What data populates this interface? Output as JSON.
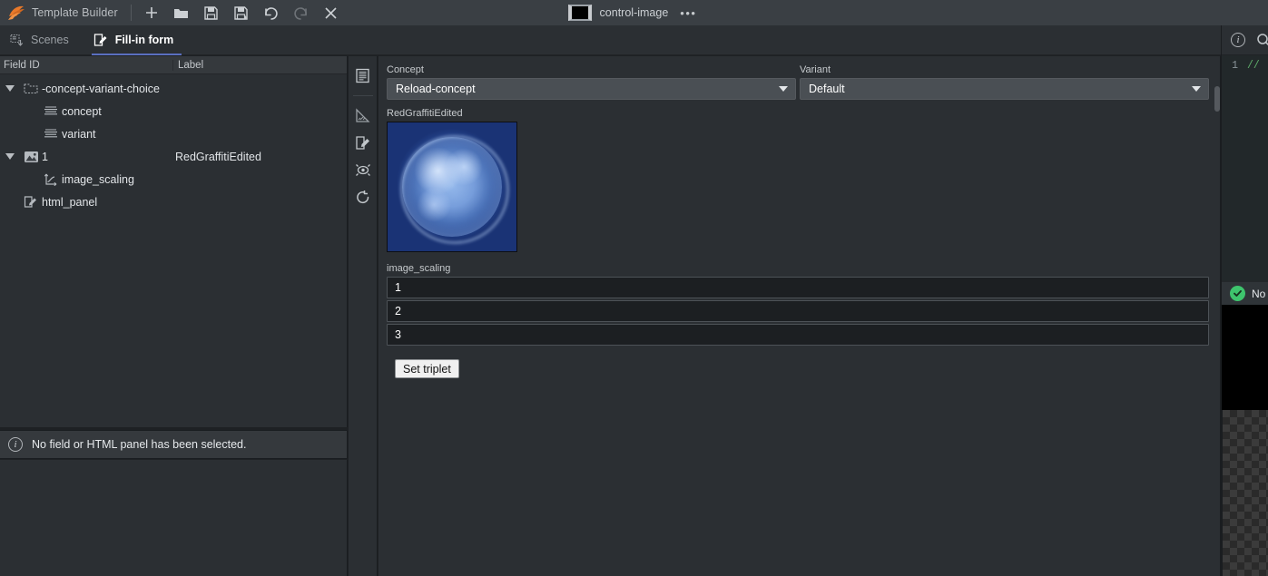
{
  "app": {
    "title": "Template Builder",
    "logo_icon": "orange-feather-logo",
    "toolbar": [
      {
        "name": "new",
        "icon": "plus-icon",
        "label": "New"
      },
      {
        "name": "open",
        "icon": "folder-open-icon",
        "label": "Open"
      },
      {
        "name": "save",
        "icon": "save-floppy-icon",
        "label": "Save"
      },
      {
        "name": "save-as",
        "icon": "save-as-floppy-icon",
        "label": "Save As"
      },
      {
        "name": "undo",
        "icon": "undo-arrow-icon",
        "label": "Undo"
      },
      {
        "name": "redo",
        "icon": "redo-arrow-icon",
        "label": "Redo"
      },
      {
        "name": "close",
        "icon": "close-x-icon",
        "label": "Close"
      }
    ],
    "document": {
      "icon": "image-strip-icon",
      "name": "control-image",
      "overflow": "•••"
    }
  },
  "tabs": [
    {
      "label": "Scenes",
      "icon": "scenes-icon",
      "active": false
    },
    {
      "label": "Fill-in form",
      "icon": "fill-in-form-icon",
      "active": true
    }
  ],
  "tree": {
    "columns": {
      "field_id": "Field ID",
      "label": "Label"
    },
    "rows": [
      {
        "id": "-concept-variant-choice",
        "label": "",
        "icon": "folder-icon",
        "indent": 0,
        "expandable": true,
        "expanded": true
      },
      {
        "id": "concept",
        "label": "",
        "icon": "list-lines-icon",
        "indent": 1,
        "expandable": false,
        "expanded": false
      },
      {
        "id": "variant",
        "label": "",
        "icon": "list-lines-icon",
        "indent": 1,
        "expandable": false,
        "expanded": false
      },
      {
        "id": "1",
        "label": "RedGraffitiEdited",
        "icon": "picture-icon",
        "indent": 0,
        "expandable": true,
        "expanded": true
      },
      {
        "id": "image_scaling",
        "label": "",
        "icon": "axes-curve-icon",
        "indent": 1,
        "expandable": false,
        "expanded": false
      },
      {
        "id": "html_panel",
        "label": "",
        "icon": "edit-pencil-icon",
        "indent": 0,
        "expandable": false,
        "expanded": false
      }
    ]
  },
  "selection_info": {
    "icon": "info-circle-icon",
    "message": "No field or HTML panel has been selected."
  },
  "rail": [
    {
      "name": "form-view",
      "icon": "document-form-icon"
    },
    {
      "name": "measure",
      "icon": "ruler-triangle-icon"
    },
    {
      "name": "edit",
      "icon": "edit-pencil-icon"
    },
    {
      "name": "preview-link",
      "icon": "link-eye-icon"
    },
    {
      "name": "refresh",
      "icon": "refresh-circle-icon"
    }
  ],
  "form": {
    "concept": {
      "label": "Concept",
      "value": "Reload-concept",
      "caret": "chevron-down-icon"
    },
    "variant": {
      "label": "Variant",
      "value": "Default",
      "caret": "chevron-down-icon"
    },
    "image": {
      "caption": "RedGraffitiEdited",
      "alt": "blue-sphere-thumbnail"
    },
    "image_scaling": {
      "label": "image_scaling",
      "values": [
        "1",
        "2",
        "3"
      ],
      "placeholder": ""
    },
    "set_triplet_button": "Set triplet"
  },
  "right_panel": {
    "header_icons": [
      {
        "name": "info",
        "icon": "info-circle-icon",
        "glyph": "i"
      },
      {
        "name": "search",
        "icon": "search-magnifier-icon",
        "glyph": "Q"
      }
    ],
    "code": {
      "line_number": "1",
      "text": "//"
    },
    "status": {
      "icon": "check-circle-icon",
      "text": "No"
    }
  },
  "colors": {
    "titlebar": "#3a3f44",
    "panel": "#2b2f33",
    "panel_alt": "#35393d",
    "accent_tab": "#5a6fc0",
    "accent_logo": "#e8792a",
    "status_ok": "#3ec46d",
    "code_comment": "#5fae6a",
    "thumb_bg": "#1a3375",
    "input_bg": "#1c1f22",
    "combo_bg": "#4a4f54"
  }
}
